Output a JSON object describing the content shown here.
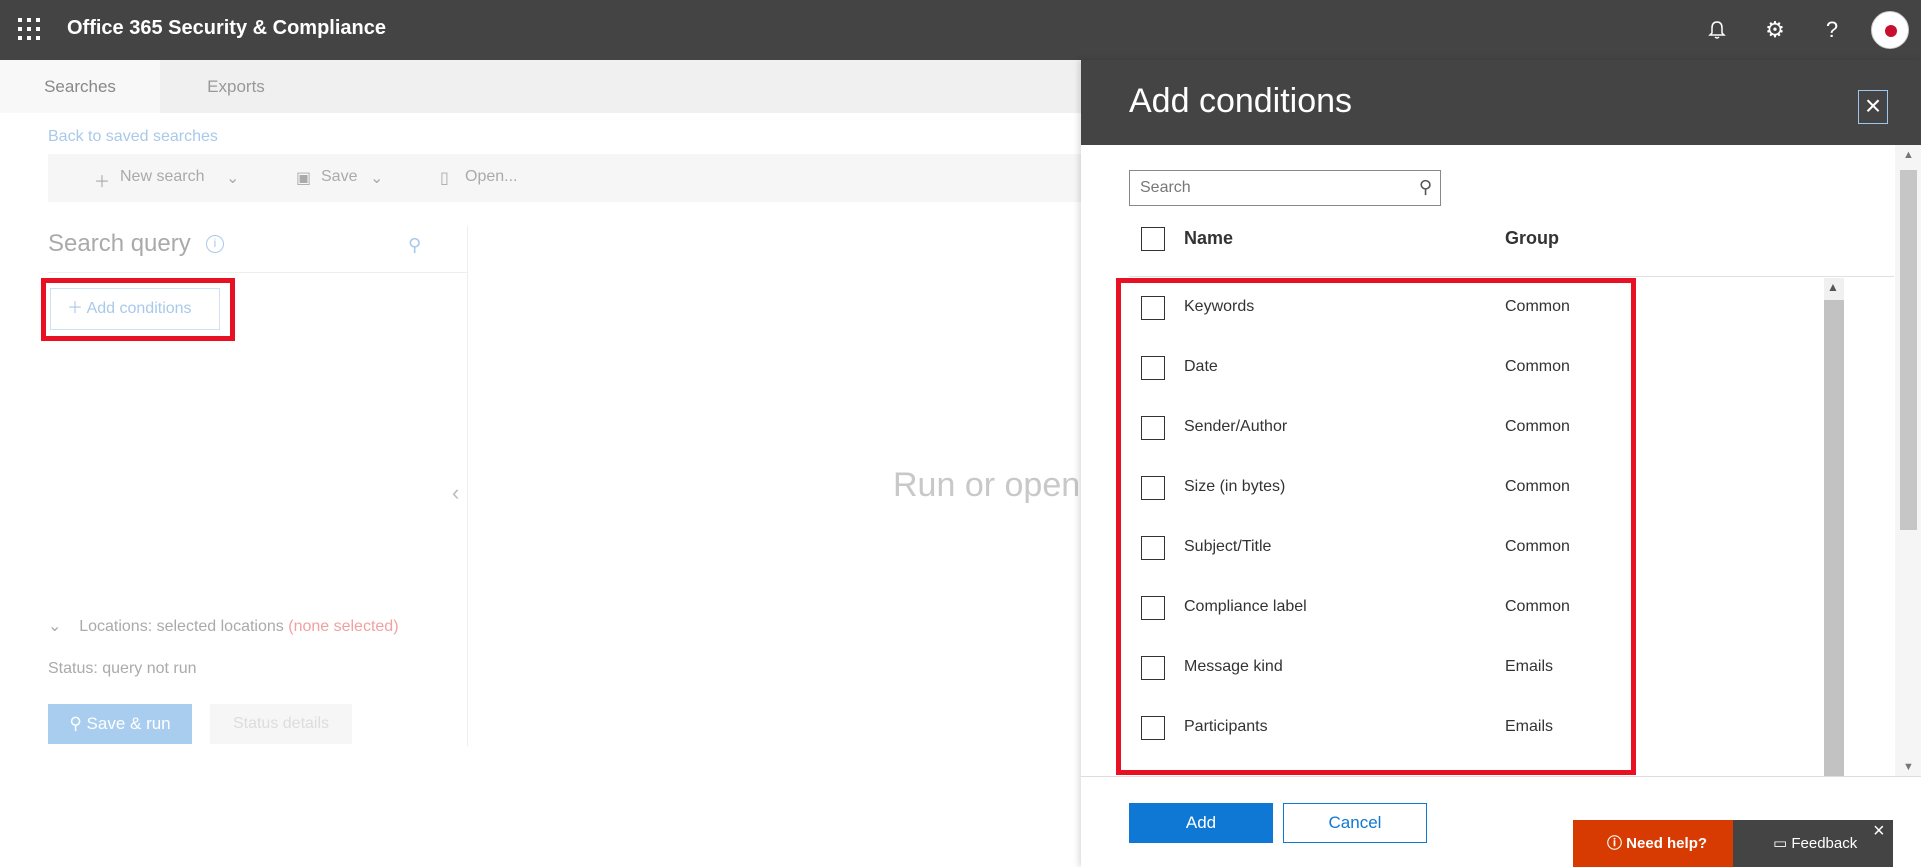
{
  "app": {
    "title": "Office 365 Security & Compliance"
  },
  "topbar": {
    "notifications_icon": "bell-icon",
    "settings_icon": "gear-icon",
    "help_label": "?"
  },
  "tabs": [
    {
      "label": "Searches"
    },
    {
      "label": "Exports"
    }
  ],
  "back_link": "Back to saved searches",
  "toolbar": {
    "new_search": "New search",
    "save": "Save",
    "open": "Open..."
  },
  "search_query": {
    "title": "Search query",
    "add_conditions_label": "Add conditions",
    "locations_label": "Locations: selected locations",
    "locations_none": "(none selected)",
    "status": "Status: query not run",
    "save_run": "Save & run",
    "status_details": "Status details"
  },
  "results": {
    "placeholder_text": "Run or open"
  },
  "panel": {
    "title": "Add conditions",
    "search_placeholder": "Search",
    "columns": {
      "name": "Name",
      "group": "Group"
    },
    "rows": [
      {
        "name": "Keywords",
        "group": "Common"
      },
      {
        "name": "Date",
        "group": "Common"
      },
      {
        "name": "Sender/Author",
        "group": "Common"
      },
      {
        "name": "Size (in bytes)",
        "group": "Common"
      },
      {
        "name": "Subject/Title",
        "group": "Common"
      },
      {
        "name": "Compliance label",
        "group": "Common"
      },
      {
        "name": "Message kind",
        "group": "Emails"
      },
      {
        "name": "Participants",
        "group": "Emails"
      }
    ],
    "add_button": "Add",
    "cancel_button": "Cancel"
  },
  "widgets": {
    "need_help": "Need help?",
    "feedback": "Feedback"
  },
  "colors": {
    "topbar": "#444444",
    "accent": "#0f78d4",
    "highlight": "#e81123",
    "help": "#d83b01"
  }
}
